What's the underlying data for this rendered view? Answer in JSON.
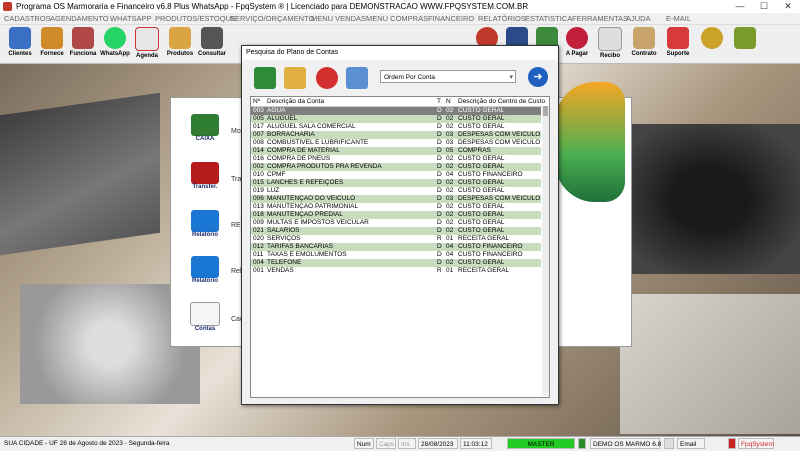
{
  "window": {
    "title": "Programa OS Marmoraria e Financeiro v6.8 Plus WhatsApp - FpqSystem ® | Licenciado para  DEMONSTRACAO WWW.FPQSYSTEM.COM.BR",
    "min": "—",
    "max": "☐",
    "close": "✕"
  },
  "menu": [
    "CADASTROS",
    "AGENDAMENTO",
    "WHATSAPP",
    "PRODUTOS/ESTOQUE",
    "SERVIÇO/ORÇAMENTO",
    "MENU VENDAS",
    "MENU COMPRAS",
    "FINANCEIRO",
    "RELATÓRIOS",
    "ESTATISTICA",
    "FERRAMENTAS",
    "AJUDA",
    "E-MAIL"
  ],
  "toolbar": [
    "Clientes",
    "Fornece",
    "Funciona",
    "WhatsApp",
    "Agenda",
    "Produtos",
    "Consultar",
    "",
    "",
    "",
    "",
    "",
    "",
    "",
    "",
    "A Pagar",
    "Recibo",
    "Contrato",
    "Suporte",
    "",
    ""
  ],
  "background_window": {
    "items": [
      {
        "icon_label": "CAIXA",
        "text": "Mov"
      },
      {
        "icon_label": "Transfer.",
        "text": "Tran"
      },
      {
        "icon_label": "Relatório",
        "text": "RES"
      },
      {
        "icon_label": "Relatório",
        "text": "Relatór"
      },
      {
        "icon_label": "Contas",
        "text": "Cadastr"
      }
    ]
  },
  "dialog": {
    "title": "Pesquisa do Plano de Contas",
    "order_select": "Ordem Por Conta",
    "go_icon": "➜",
    "columns": {
      "num": "Nº",
      "desc": "Descrição da Conta",
      "t": "T",
      "n": "N",
      "centro": "Descrição do Centro de Custo"
    },
    "rows": [
      {
        "num": "003",
        "desc": "AGUA",
        "t": "D",
        "n": "02",
        "centro": "CUSTO GERAL"
      },
      {
        "num": "005",
        "desc": "ALUGUEL",
        "t": "D",
        "n": "02",
        "centro": "CUSTO GERAL"
      },
      {
        "num": "017",
        "desc": "ALUGUEL SALA COMERCIAL",
        "t": "D",
        "n": "02",
        "centro": "CUSTO GERAL"
      },
      {
        "num": "007",
        "desc": "BORRACHARIA",
        "t": "D",
        "n": "03",
        "centro": "DESPESAS COM VEICULO"
      },
      {
        "num": "008",
        "desc": "COMBUSTIVEL E LUBRIFICANTE",
        "t": "D",
        "n": "03",
        "centro": "DESPESAS COM VEICULO"
      },
      {
        "num": "014",
        "desc": "COMPRA DE MATERIAL",
        "t": "D",
        "n": "05",
        "centro": "COMPRAS"
      },
      {
        "num": "016",
        "desc": "COMPRA DE PNEUS",
        "t": "D",
        "n": "02",
        "centro": "CUSTO GERAL"
      },
      {
        "num": "002",
        "desc": "COMPRA PRODUTOS PRA REVENDA",
        "t": "D",
        "n": "02",
        "centro": "CUSTO GERAL"
      },
      {
        "num": "010",
        "desc": "CPMF",
        "t": "D",
        "n": "04",
        "centro": "CUSTO FINANCEIRO"
      },
      {
        "num": "015",
        "desc": "LANCHES E REFEIÇÕES",
        "t": "D",
        "n": "02",
        "centro": "CUSTO GERAL"
      },
      {
        "num": "019",
        "desc": "LUZ",
        "t": "D",
        "n": "02",
        "centro": "CUSTO GERAL"
      },
      {
        "num": "006",
        "desc": "MANUTENÇÃO DO VEICULO",
        "t": "D",
        "n": "03",
        "centro": "DESPESAS COM VEICULO"
      },
      {
        "num": "013",
        "desc": "MANUTENÇÃO PATRIMONIAL",
        "t": "D",
        "n": "02",
        "centro": "CUSTO GERAL"
      },
      {
        "num": "018",
        "desc": "MANUTENÇÃO PREDIAL",
        "t": "D",
        "n": "02",
        "centro": "CUSTO GERAL"
      },
      {
        "num": "009",
        "desc": "MULTAS E IMPOSTOS VEICULAR",
        "t": "D",
        "n": "02",
        "centro": "CUSTO GERAL"
      },
      {
        "num": "021",
        "desc": "SALARIOS",
        "t": "D",
        "n": "02",
        "centro": "CUSTO GERAL"
      },
      {
        "num": "020",
        "desc": "SERVIÇOS",
        "t": "R",
        "n": "01",
        "centro": "RECEITA GERAL"
      },
      {
        "num": "012",
        "desc": "TARIFAS BANCÁRIAS",
        "t": "D",
        "n": "04",
        "centro": "CUSTO FINANCEIRO"
      },
      {
        "num": "011",
        "desc": "TAXAS E EMOLUMENTOS",
        "t": "D",
        "n": "04",
        "centro": "CUSTO FINANCEIRO"
      },
      {
        "num": "004",
        "desc": "TELEFONE",
        "t": "D",
        "n": "02",
        "centro": "CUSTO GERAL"
      },
      {
        "num": "001",
        "desc": "VENDAS",
        "t": "R",
        "n": "01",
        "centro": "RECEITA GERAL"
      }
    ]
  },
  "status": {
    "city": "SUA CIDADE - UF 28 de Agosto de 2023 - Segunda-feira",
    "num": "Num",
    "caps": "Caps",
    "ins": "Ins",
    "date": "28/08/2023",
    "time": "11:03:12",
    "master": "MASTER",
    "demo": "DEMO OS MARMO 6.8",
    "email": "Email",
    "brand": "FpqSystem"
  },
  "colors": {
    "row_alt": "#c8dcc0",
    "selected": "#7f7f7f",
    "master": "#22cc22",
    "brand": "#cc2222"
  }
}
